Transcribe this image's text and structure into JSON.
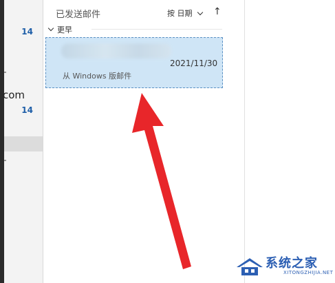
{
  "folder_pane": {
    "counts": [
      "14",
      "14"
    ],
    "partial_text": "com"
  },
  "list_header": {
    "folder_title": "已发送邮件",
    "sort_label": "按 日期",
    "sort_direction_glyph": "↑"
  },
  "group": {
    "label": "更早"
  },
  "message": {
    "date": "2021/11/30",
    "preview": "从 Windows 版邮件"
  },
  "watermark": {
    "text": "系统之家",
    "sub": "XITONGZHIJIA.NET"
  },
  "colors": {
    "selected_bg": "#cfe5f6",
    "selected_border": "#5a90c3",
    "count_blue": "#1f5fa8",
    "arrow_red": "#e8262a"
  }
}
